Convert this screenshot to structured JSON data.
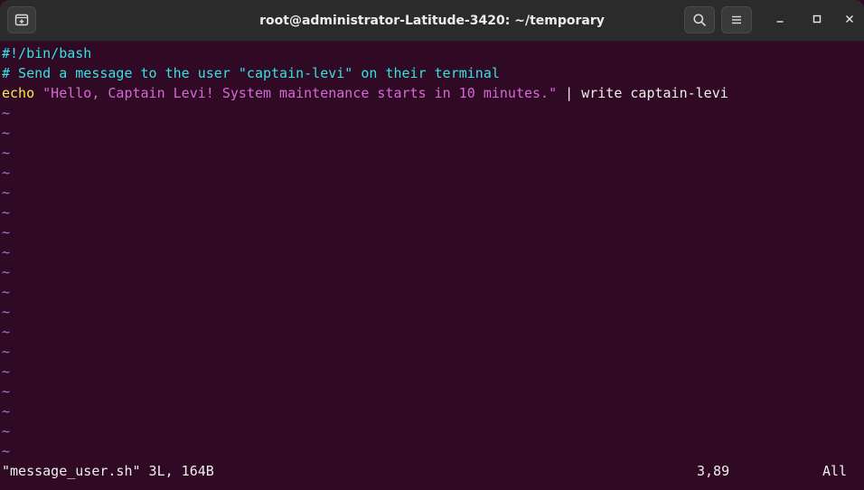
{
  "window": {
    "title": "root@administrator-Latitude-3420: ~/temporary"
  },
  "editor": {
    "lines": [
      {
        "parts": [
          {
            "cls": "shebang",
            "text": "#!/bin/bash"
          }
        ]
      },
      {
        "parts": [
          {
            "cls": "comment",
            "text": "# Send a message to the user \"captain-levi\" on their terminal"
          }
        ]
      },
      {
        "parts": [
          {
            "cls": "keyword",
            "text": "echo"
          },
          {
            "cls": "plain",
            "text": " "
          },
          {
            "cls": "string",
            "text": "\"Hello, Captain Levi! System maintenance starts in 10 minutes.\""
          },
          {
            "cls": "plain",
            "text": " | write captain-levi"
          }
        ]
      }
    ],
    "tilde": "~",
    "empty_line_count": 18
  },
  "status": {
    "file_info": "\"message_user.sh\" 3L, 164B",
    "cursor_position": "3,89",
    "scroll": "All"
  },
  "icons": {
    "new_tab": "new-tab-icon",
    "search": "search-icon",
    "menu": "hamburger-menu-icon",
    "minimize": "minimize-icon",
    "maximize": "maximize-icon",
    "close": "close-icon"
  },
  "colors": {
    "background": "#300a24",
    "titlebar": "#2b2b2b",
    "comment": "#34e2e2",
    "keyword": "#fce94f",
    "string": "#d46ad3",
    "tilde": "#8f7fd6"
  }
}
